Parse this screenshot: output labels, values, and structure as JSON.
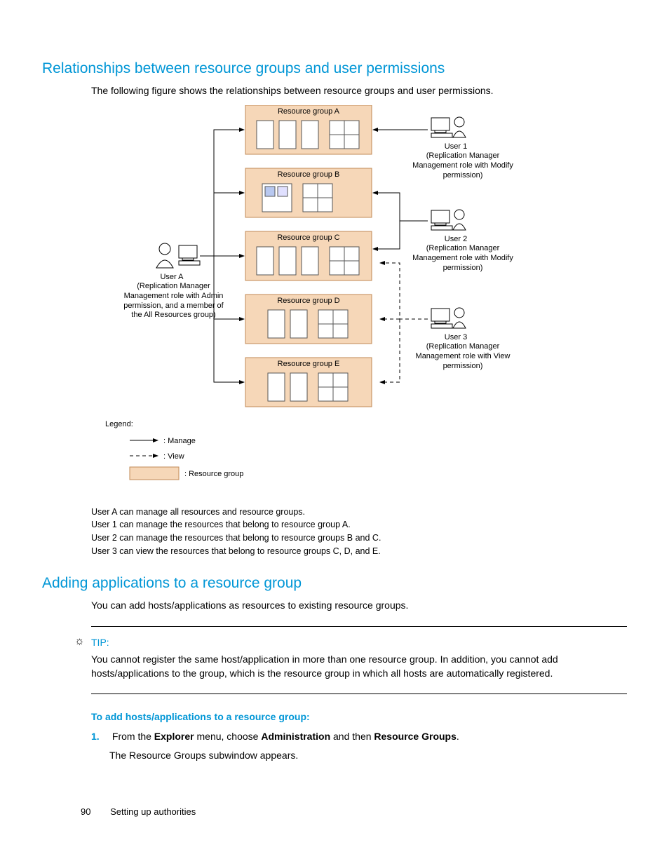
{
  "heading1": "Relationships between resource groups and user permissions",
  "intro1": "The following figure shows the relationships between resource groups and user permissions.",
  "diagram": {
    "groups": [
      {
        "label": "Resource group A"
      },
      {
        "label": "Resource group B"
      },
      {
        "label": "Resource group C"
      },
      {
        "label": "Resource group D"
      },
      {
        "label": "Resource group E"
      }
    ],
    "userA": {
      "name": "User A",
      "desc": "(Replication Manager Management role with Admin permission, and a member of the All Resources group)"
    },
    "user1": {
      "name": "User 1",
      "desc": "(Replication Manager Management role with Modify permission)"
    },
    "user2": {
      "name": "User 2",
      "desc": "(Replication Manager Management role with Modify permission)"
    },
    "user3": {
      "name": "User 3",
      "desc": "(Replication Manager Management role with View permission)"
    },
    "legend": {
      "title": "Legend:",
      "manage": ": Manage",
      "view": ": View",
      "rg": ": Resource group"
    },
    "captions": {
      "l1": "User A can manage all resources and resource groups.",
      "l2": "User 1 can manage the resources that belong to resource group A.",
      "l3": "User 2 can manage the resources that belong to resource groups B and C.",
      "l4": "User 3 can view the resources that belong to resource groups C, D, and E."
    }
  },
  "heading2": "Adding applications to a resource group",
  "intro2": "You can add hosts/applications as resources to existing resource groups.",
  "tip": {
    "label": "TIP:",
    "text": "You cannot register the same host/application in more than one resource group. In addition, you cannot add hosts/applications to the                                  group, which is the resource group in which all hosts are automatically registered."
  },
  "subhead": "To add hosts/applications to a resource group:",
  "step1": {
    "num": "1.",
    "prefix": "From the ",
    "b1": "Explorer",
    "mid1": " menu, choose ",
    "b2": "Administration",
    "mid2": " and then ",
    "b3": "Resource Groups",
    "suffix": ".",
    "line2": "The Resource Groups subwindow appears."
  },
  "footer": {
    "page": "90",
    "section": "Setting up authorities"
  }
}
